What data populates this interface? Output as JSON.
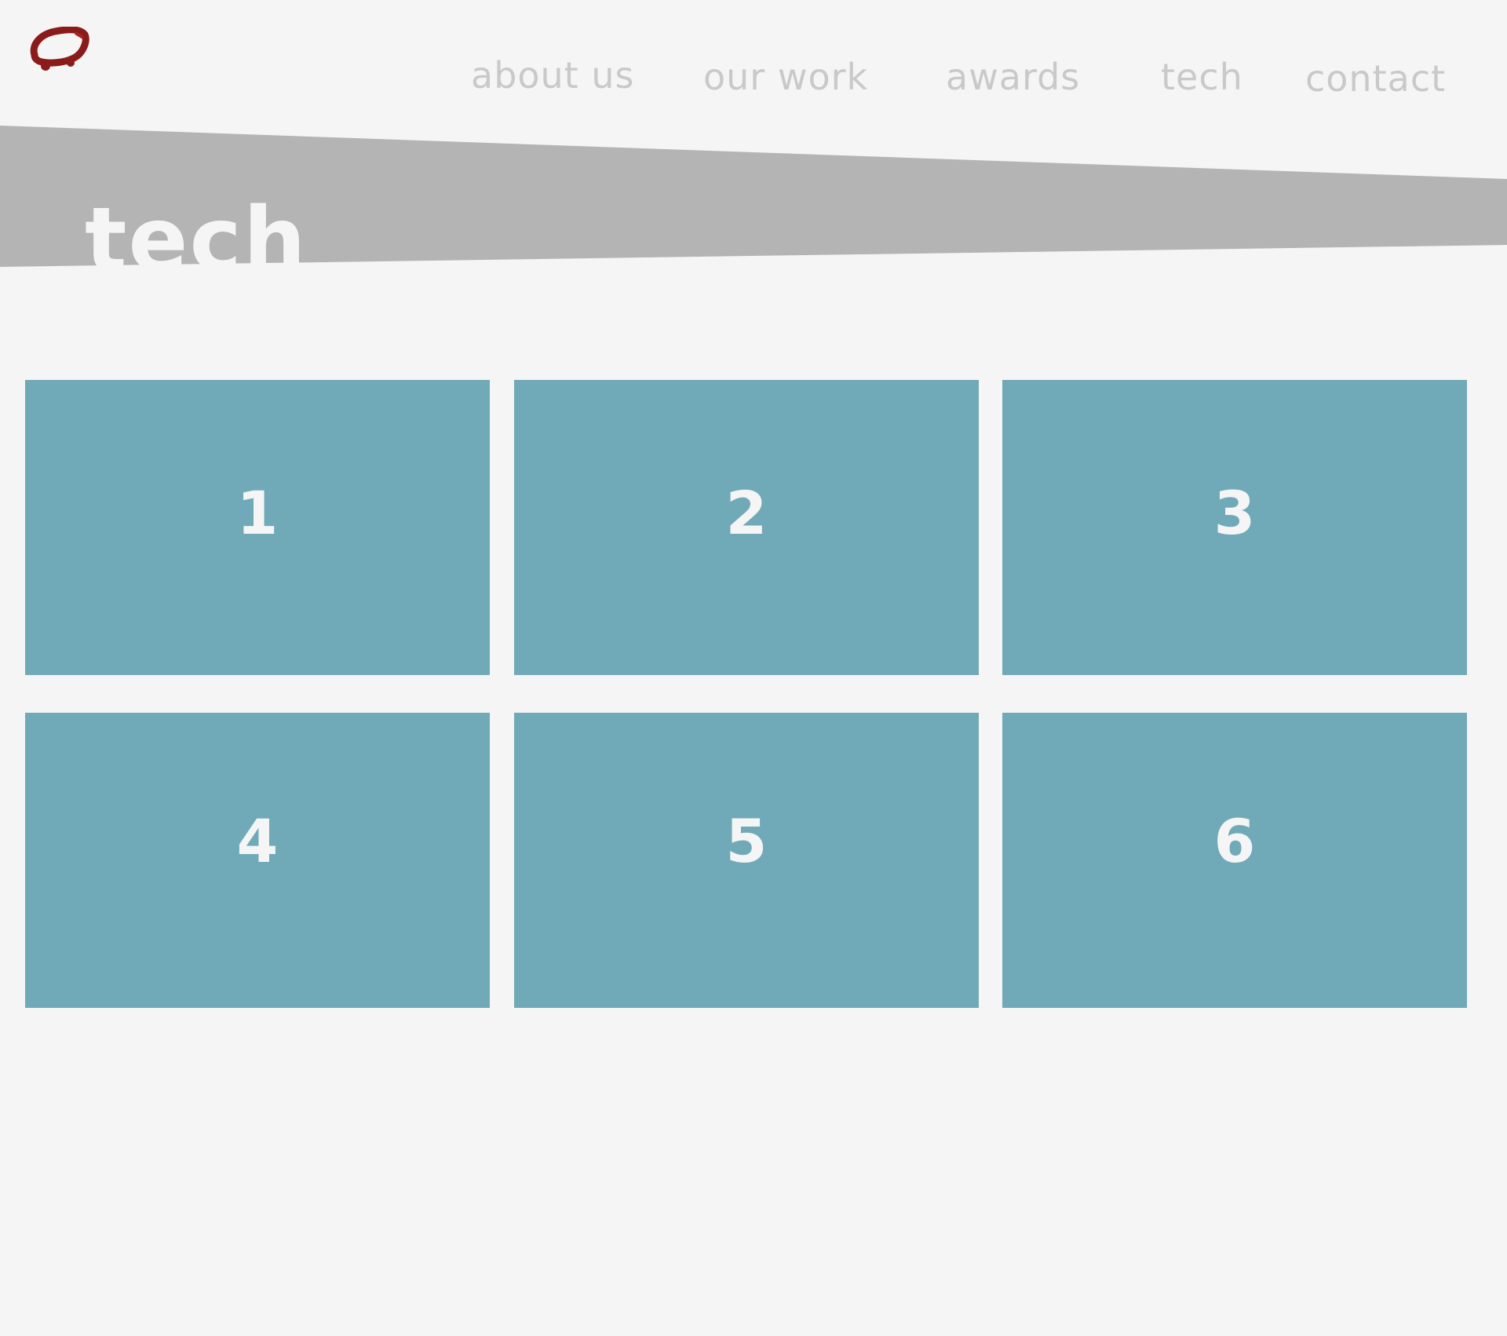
{
  "header": {
    "logo": {
      "icon": "red-outline-logo-icon",
      "color": "#8b1a1a"
    },
    "nav": [
      {
        "label": "about us"
      },
      {
        "label": "our work"
      },
      {
        "label": "awards"
      },
      {
        "label": "tech"
      },
      {
        "label": "contact"
      }
    ]
  },
  "banner": {
    "title": "tech",
    "band_color": "#b4b4b4"
  },
  "grid": {
    "tile_color": "#70aab8",
    "tiles": [
      {
        "label": "1"
      },
      {
        "label": "2"
      },
      {
        "label": "3"
      },
      {
        "label": "4"
      },
      {
        "label": "5"
      },
      {
        "label": "6"
      }
    ]
  },
  "colors": {
    "background": "#f5f5f5",
    "nav_text": "#c9c9c9",
    "title_text": "#f5f5f5"
  }
}
